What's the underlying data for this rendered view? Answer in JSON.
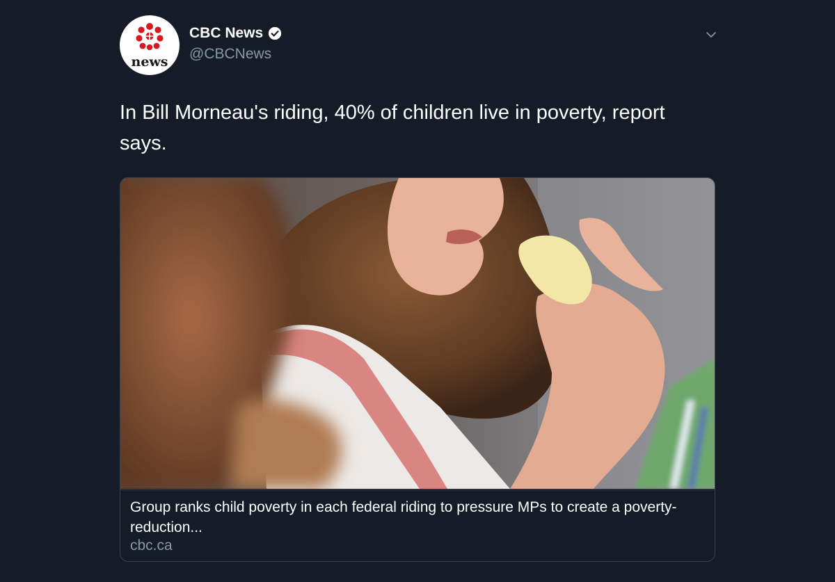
{
  "account": {
    "display_name": "CBC News",
    "handle": "@CBCNews",
    "avatar_logo_text": "news",
    "verified": true
  },
  "tweet": {
    "text": "In Bill Morneau's riding, 40% of children live in poverty, report says."
  },
  "card": {
    "title": "Group ranks child poverty in each federal riding to pressure MPs to create a poverty-reduction...",
    "domain": "cbc.ca"
  },
  "icons": {
    "verified": "verified-badge-icon",
    "menu": "chevron-down-icon"
  },
  "colors": {
    "background": "#151c27",
    "secondary_text": "#8899a6",
    "card_border": "#38444d",
    "cbc_red": "#d71920"
  }
}
